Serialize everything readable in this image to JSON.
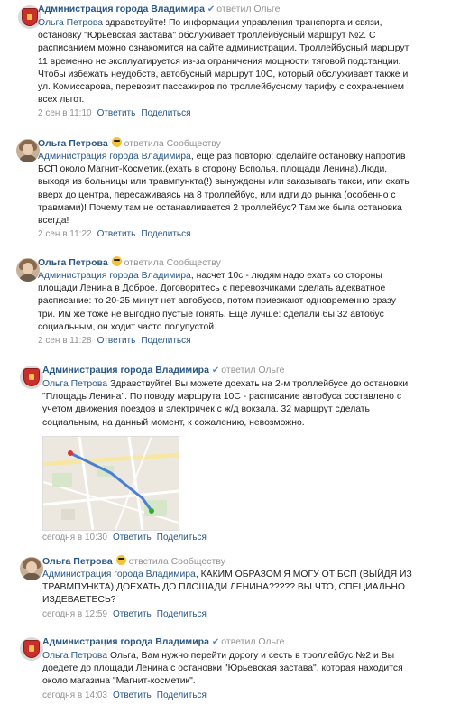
{
  "comments": [
    {
      "author": "Администрация города Владимира",
      "action": "ответил Ольге",
      "lines": [
        {
          "mention": "Ольга Петрова",
          "text": " здравствуйте! По информации управления транспорта и связи,"
        },
        {
          "text": "остановку \"Юрьевская застава\" обслуживает троллейбусный маршрут №2. С"
        },
        {
          "text": "расписанием можно ознакомится на сайте администрации. Троллейбусный маршрут"
        },
        {
          "text": "11 временно не эксплуатируется из-за ограничения мощности тяговой подстанции."
        },
        {
          "text": "Чтобы избежать неудобств, автобусный маршрут 10С, который обслуживает также и"
        },
        {
          "text": "ул. Комиссарова, перевозит пассажиров по троллейбусному тарифу с сохранением"
        },
        {
          "text": "всех льгот."
        }
      ],
      "date": "2 сен в 11:10",
      "reply": "Ответить",
      "share": "Поделиться"
    },
    {
      "author": "Ольга Петрова",
      "action": "ответила Сообществу",
      "lines": [
        {
          "mention": "Администрация города Владимира",
          "text": ", ещё раз повторю: сделайте остановку напротив"
        },
        {
          "text": "БСП около Магнит-Косметик.(ехать в сторону Всполья, площади Ленина).Люди,"
        },
        {
          "text": "выходя из больницы или травмпункта(!) вынуждены или заказывать такси, или ехать"
        },
        {
          "text": "вверх до центра, пересаживаясь на 8 троллейбус, или идти до рынка (особенно с"
        },
        {
          "text": "травмами)! Почему там не останавливается 2 троллейбус? Там же была остановка"
        },
        {
          "text": "всегда!"
        }
      ],
      "date": "2 сен в 11:22",
      "reply": "Ответить",
      "share": "Поделиться"
    },
    {
      "author": "Ольга Петрова",
      "action": "ответила Сообществу",
      "lines": [
        {
          "mention": "Администрация города Владимира",
          "text": ", насчет 10с - людям надо ехать со стороны"
        },
        {
          "text": "площади Ленина в Доброе. Договоритесь с перевозчиками сделать адекватное"
        },
        {
          "text": "расписание: то 20-25 минут нет автобусов, потом приезжают одновременно сразу"
        },
        {
          "text": "три. Им же тоже не выгодно пустые гонять. Ещё лучше: сделали бы 32 автобус"
        },
        {
          "text": "социальным, он ходит часто полупустой."
        }
      ],
      "date": "2 сен в 11:28",
      "reply": "Ответить",
      "share": "Поделиться"
    },
    {
      "author": "Администрация города Владимира",
      "action": "ответил Ольге",
      "lines": [
        {
          "mention": "Ольга Петрова",
          "text": " Здравствуйте! Вы можете доехать на 2-м троллейбусе до остановки"
        },
        {
          "text": "\"Площадь Ленина\". По поводу маршрута 10С - расписание автобуса составлено с"
        },
        {
          "text": "учетом движения поездов и электричек с ж/д вокзала. 32 маршрут сделать"
        },
        {
          "text": "социальным, на данный момент, к сожалению, невозможно."
        }
      ],
      "date": "сегодня в 10:30",
      "reply": "Ответить",
      "share": "Поделиться"
    },
    {
      "author": "Ольга Петрова",
      "action": "ответила Сообществу",
      "lines": [
        {
          "mention": "Администрация города Владимира",
          "text": ", КАКИМ ОБРАЗОМ Я МОГУ ОТ БСП (ВЫЙДЯ ИЗ"
        },
        {
          "text": "ТРАВМПУНКТА) ДОЕХАТЬ ДО ПЛОЩАДИ ЛЕНИНА????? ВЫ ЧТО, СПЕЦИАЛЬНО"
        },
        {
          "text": "ИЗДЕВАЕТЕСЬ?"
        }
      ],
      "date": "сегодня в 12:59",
      "reply": "Ответить",
      "share": "Поделиться"
    },
    {
      "author": "Администрация города Владимира",
      "action": "ответил Ольге",
      "lines": [
        {
          "mention": "Ольга Петрова",
          "text": " Ольга, Вам нужно перейти дорогу и сесть в троллейбус №2 и Вы"
        },
        {
          "text": "доедете до площади Ленина с остановки \"Юрьевская застава\", которая находится"
        },
        {
          "text": "около магазина \"Магнит-косметик\"."
        }
      ],
      "date": "сегодня в 14:03",
      "reply": "Ответить",
      "share": "Поделиться"
    }
  ]
}
